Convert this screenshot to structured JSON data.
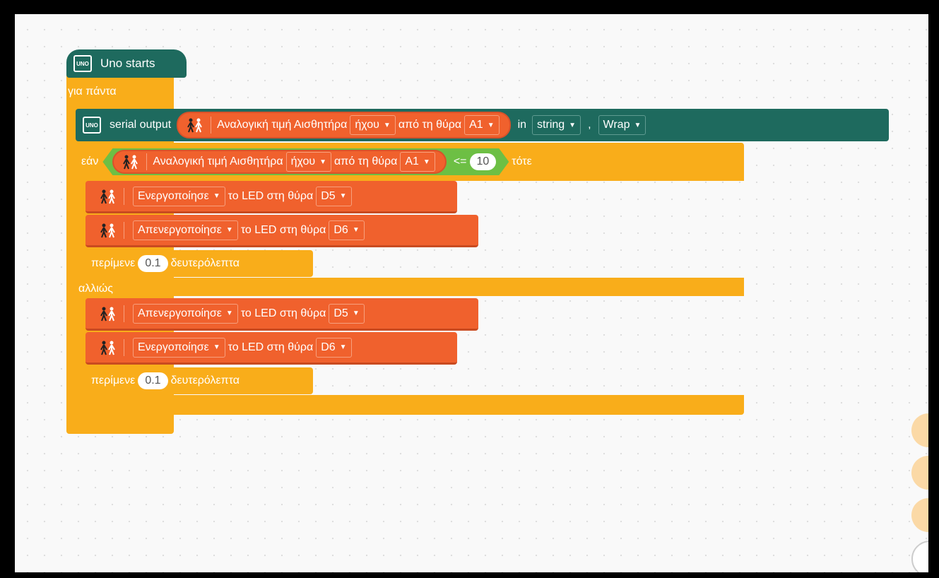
{
  "hat": {
    "label": "Uno starts",
    "board_icon": "UNO"
  },
  "forever": {
    "label": "για πάντα"
  },
  "serial": {
    "label": "serial output",
    "sensor_text": "Αναλογική τιμή Αισθητήρα",
    "sensor_type": "ήχου",
    "from_port_text": "από τη θύρα",
    "port": "A1",
    "in_label": "in",
    "type_value": "string",
    "comma": ",",
    "wrap_value": "Wrap"
  },
  "if_block": {
    "if_label": "εάν",
    "sensor_text": "Αναλογική τιμή Αισθητήρα",
    "sensor_type": "ήχου",
    "from_port_text": "από τη θύρα",
    "port": "A1",
    "operator": "<=",
    "threshold": "10",
    "then_label": "τότε",
    "else_label": "αλλιώς"
  },
  "then_actions": [
    {
      "action": "Ενεργοποίησε",
      "led_text": "το LED στη θύρα",
      "port": "D5"
    },
    {
      "action": "Απενεργοποίησε",
      "led_text": "το LED στη θύρα",
      "port": "D6"
    }
  ],
  "then_wait": {
    "label": "περίμενε",
    "value": "0.1",
    "unit": "δευτερόλεπτα"
  },
  "else_actions": [
    {
      "action": "Απενεργοποίησε",
      "led_text": "το LED στη θύρα",
      "port": "D5"
    },
    {
      "action": "Ενεργοποίησε",
      "led_text": "το LED στη θύρα",
      "port": "D6"
    }
  ],
  "else_wait": {
    "label": "περίμενε",
    "value": "0.1",
    "unit": "δευτερόλεπτα"
  },
  "colors": {
    "control": "#f9ad1a",
    "board": "#1e6a5e",
    "led": "#f0612d",
    "operator": "#6dbf44"
  },
  "icons": [
    "uno-board-icon",
    "people-sensor-icon",
    "dropdown-caret-icon"
  ]
}
